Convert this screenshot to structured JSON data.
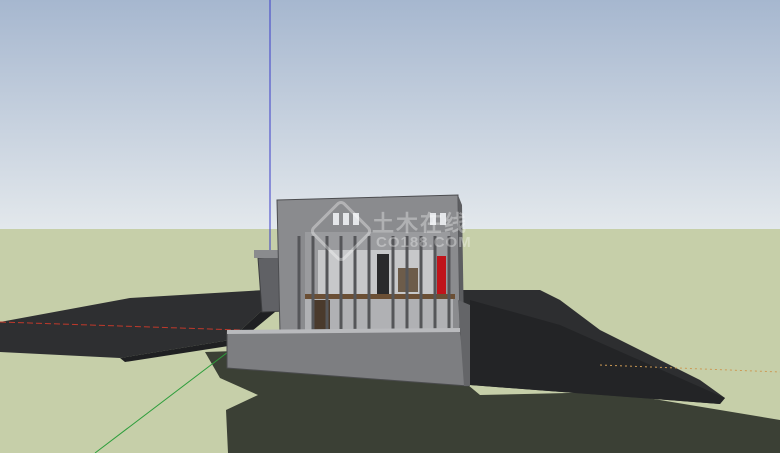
{
  "scene": {
    "sky_top_color": "#a6b7cf",
    "sky_horizon_color": "#e2e7ec",
    "ground_color": "#c6cfa9",
    "shadow_color": "#3a3f33",
    "slab_color": "#2f3033",
    "wall_color": "#7f8083",
    "axis_blue": "#3b3ec8",
    "axis_red": "#c0392b",
    "axis_green": "#2e9e3c",
    "accent_red_panel": "#c0141b"
  },
  "watermark": {
    "title": "土木在线",
    "subtitle": "CO188.COM"
  }
}
